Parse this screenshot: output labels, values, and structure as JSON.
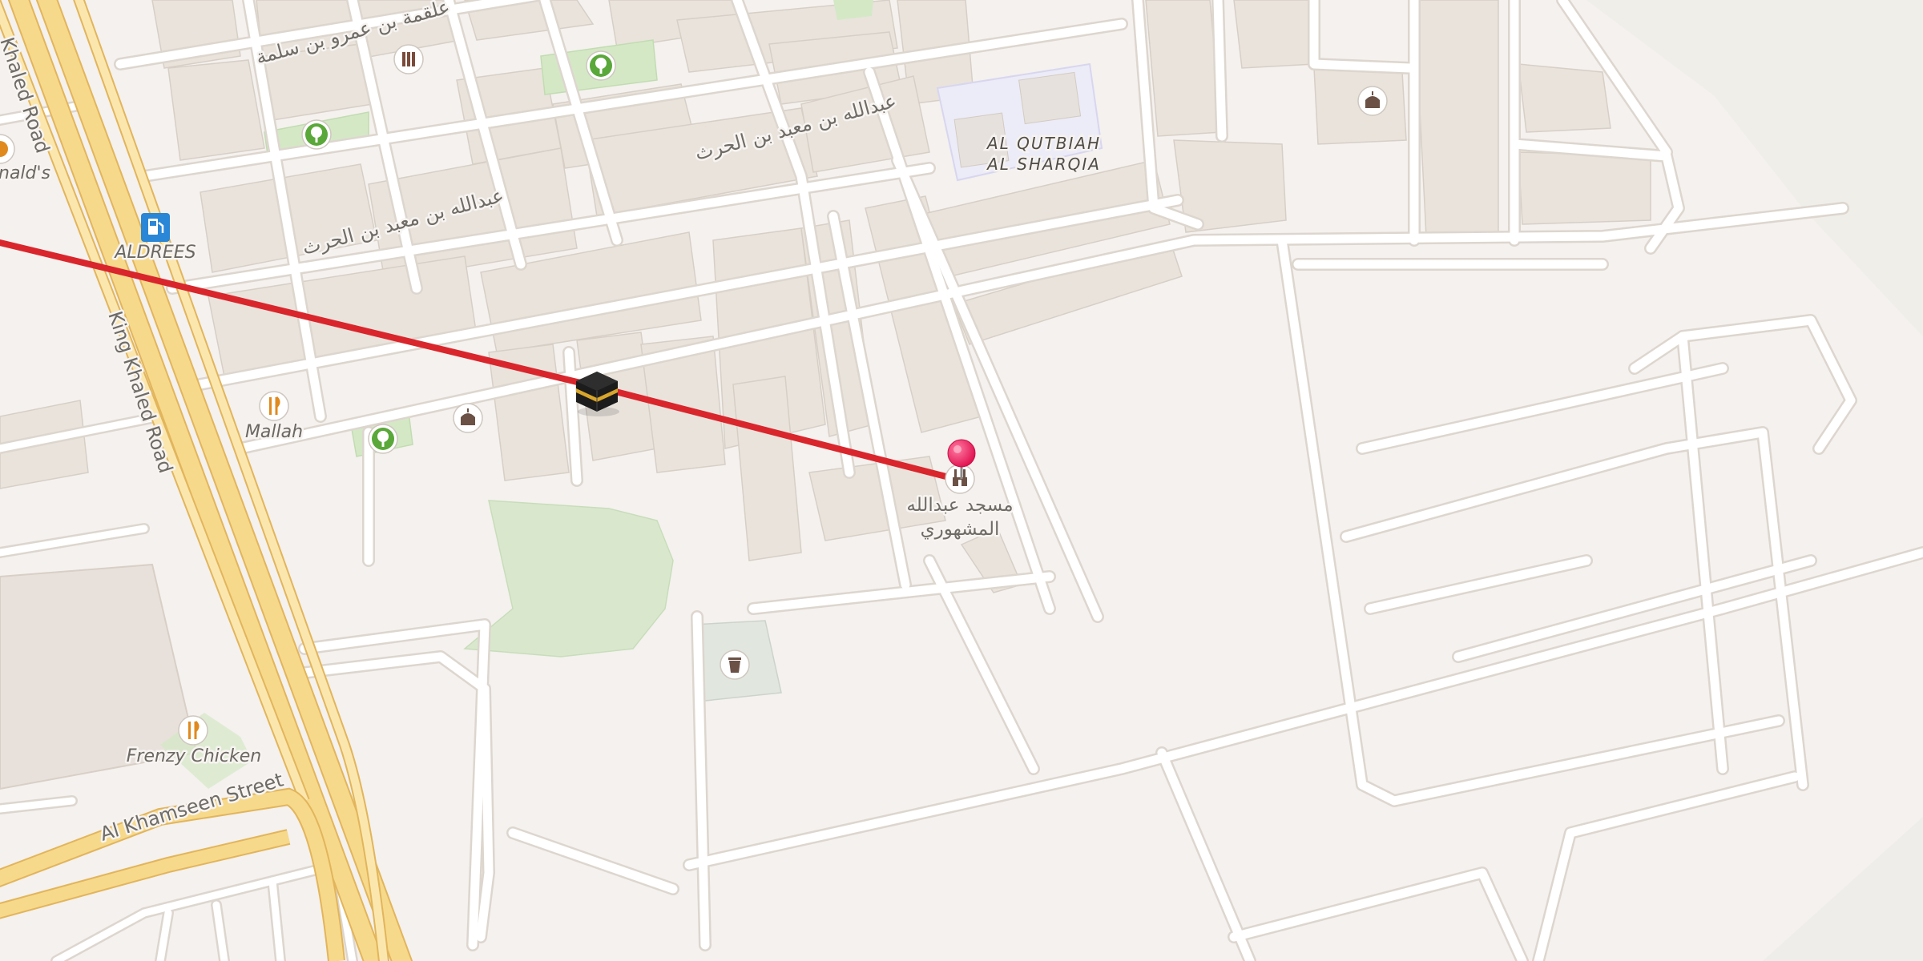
{
  "map": {
    "colors": {
      "background": "#f4f1ee",
      "motorway": "#f7d98b",
      "motorway_casing": "#e2b55c",
      "route_line": "#d9262c",
      "park": "#d4e8c6",
      "district_area": "#ecebf8",
      "pin": "#f0145a"
    },
    "roads": {
      "king_khaled": "King Khaled Road",
      "king_khaled_top": "Khaled Road",
      "al_khamseen": "Al Khamseen Street",
      "arabic_1": "علقمة بن عمرو بن سلمة",
      "arabic_2": "عبدالله بن معبد بن الحرث",
      "arabic_3": "عبدالله بن معبد بن الحرث"
    },
    "district": {
      "line1": "AL QUTBIAH",
      "line2": "AL SHARQIA"
    },
    "pois": {
      "mcdonalds": "nald's",
      "aldrees": "ALDREES",
      "mallah": "Mallah",
      "frenzy": "Frenzy Chicken",
      "mosque_line1": "مسجد عبدالله",
      "mosque_line2": "المشهوري"
    },
    "icons": {
      "kaaba": "kaaba-icon",
      "pin": "map-pin-icon",
      "fuel": "fuel-pump-icon",
      "restaurant": "restaurant-icon",
      "mosque": "mosque-icon",
      "park": "tree-icon",
      "books": "library-icon",
      "trash": "waste-icon"
    }
  }
}
